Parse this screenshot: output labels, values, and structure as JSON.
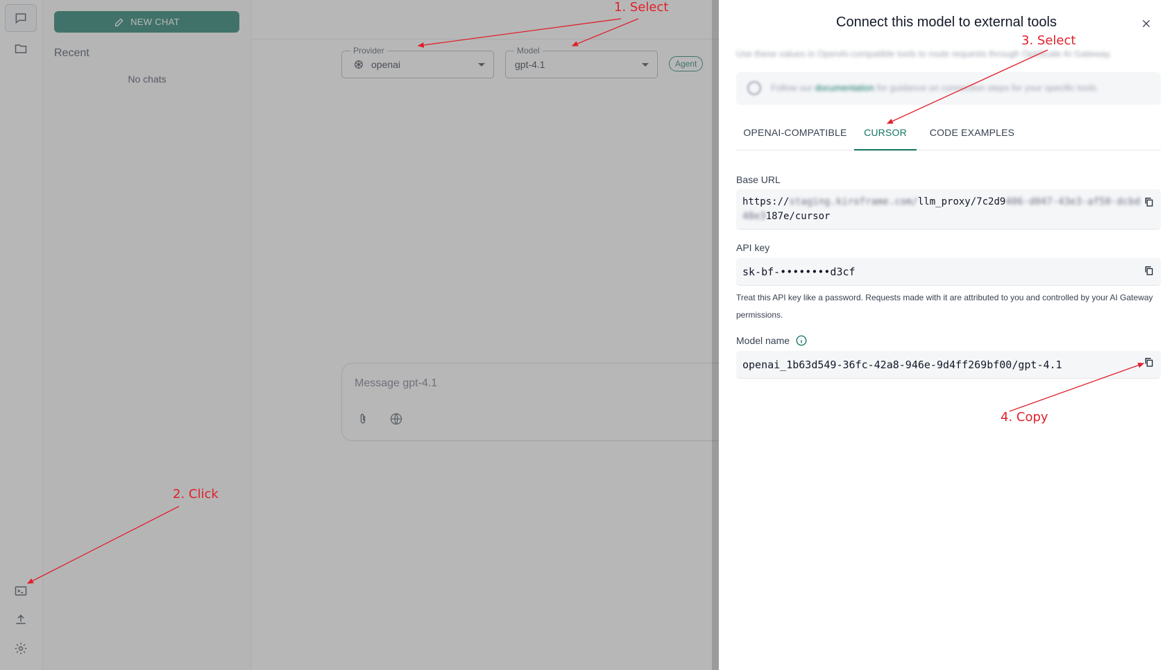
{
  "sidebar": {
    "new_chat_label": "NEW CHAT",
    "recent_label": "Recent",
    "empty_label": "No chats"
  },
  "toolbar": {
    "provider": {
      "legend": "Provider",
      "value": "openai"
    },
    "model": {
      "legend": "Model",
      "value": "gpt-4.1"
    },
    "agent_chip": "Agent"
  },
  "composer": {
    "placeholder": "Message gpt-4.1"
  },
  "drawer": {
    "title": "Connect this model to external tools",
    "description": "Use these values in OpenAI-compatible tools to route requests through OptiScale AI Gateway.",
    "info": {
      "prefix": "Follow our",
      "link": "documentation",
      "suffix": "for guidance on connection steps for your specific tools."
    },
    "tabs": [
      {
        "label": "OPENAI-COMPATIBLE",
        "active": false
      },
      {
        "label": "CURSOR",
        "active": true
      },
      {
        "label": "CODE EXAMPLES",
        "active": false
      }
    ],
    "base_url": {
      "label": "Base URL",
      "line1_a": "https://",
      "line1_blur": "staging.kiroframe.com/",
      "line1_b": "llm_proxy/7c2d9",
      "line1_blur2": "406-d047-43e3-af50-dcbd",
      "line2_blur": "48e3",
      "line2_b": "187e/cursor"
    },
    "api_key": {
      "label": "API key",
      "value": "sk-bf-••••••••d3cf",
      "hint": "Treat this API key like a password. Requests made with it are attributed to you and controlled by your AI Gateway permissions."
    },
    "model_name": {
      "label": "Model name",
      "value": "openai_1b63d549-36fc-42a8-946e-9d4ff269bf00/gpt-4.1"
    }
  },
  "annotations": {
    "step1": "1. Select",
    "step2": "2. Click",
    "step3": "3. Select",
    "step4": "4. Copy",
    "color": "#e0202a"
  },
  "colors": {
    "accent": "#127562"
  }
}
